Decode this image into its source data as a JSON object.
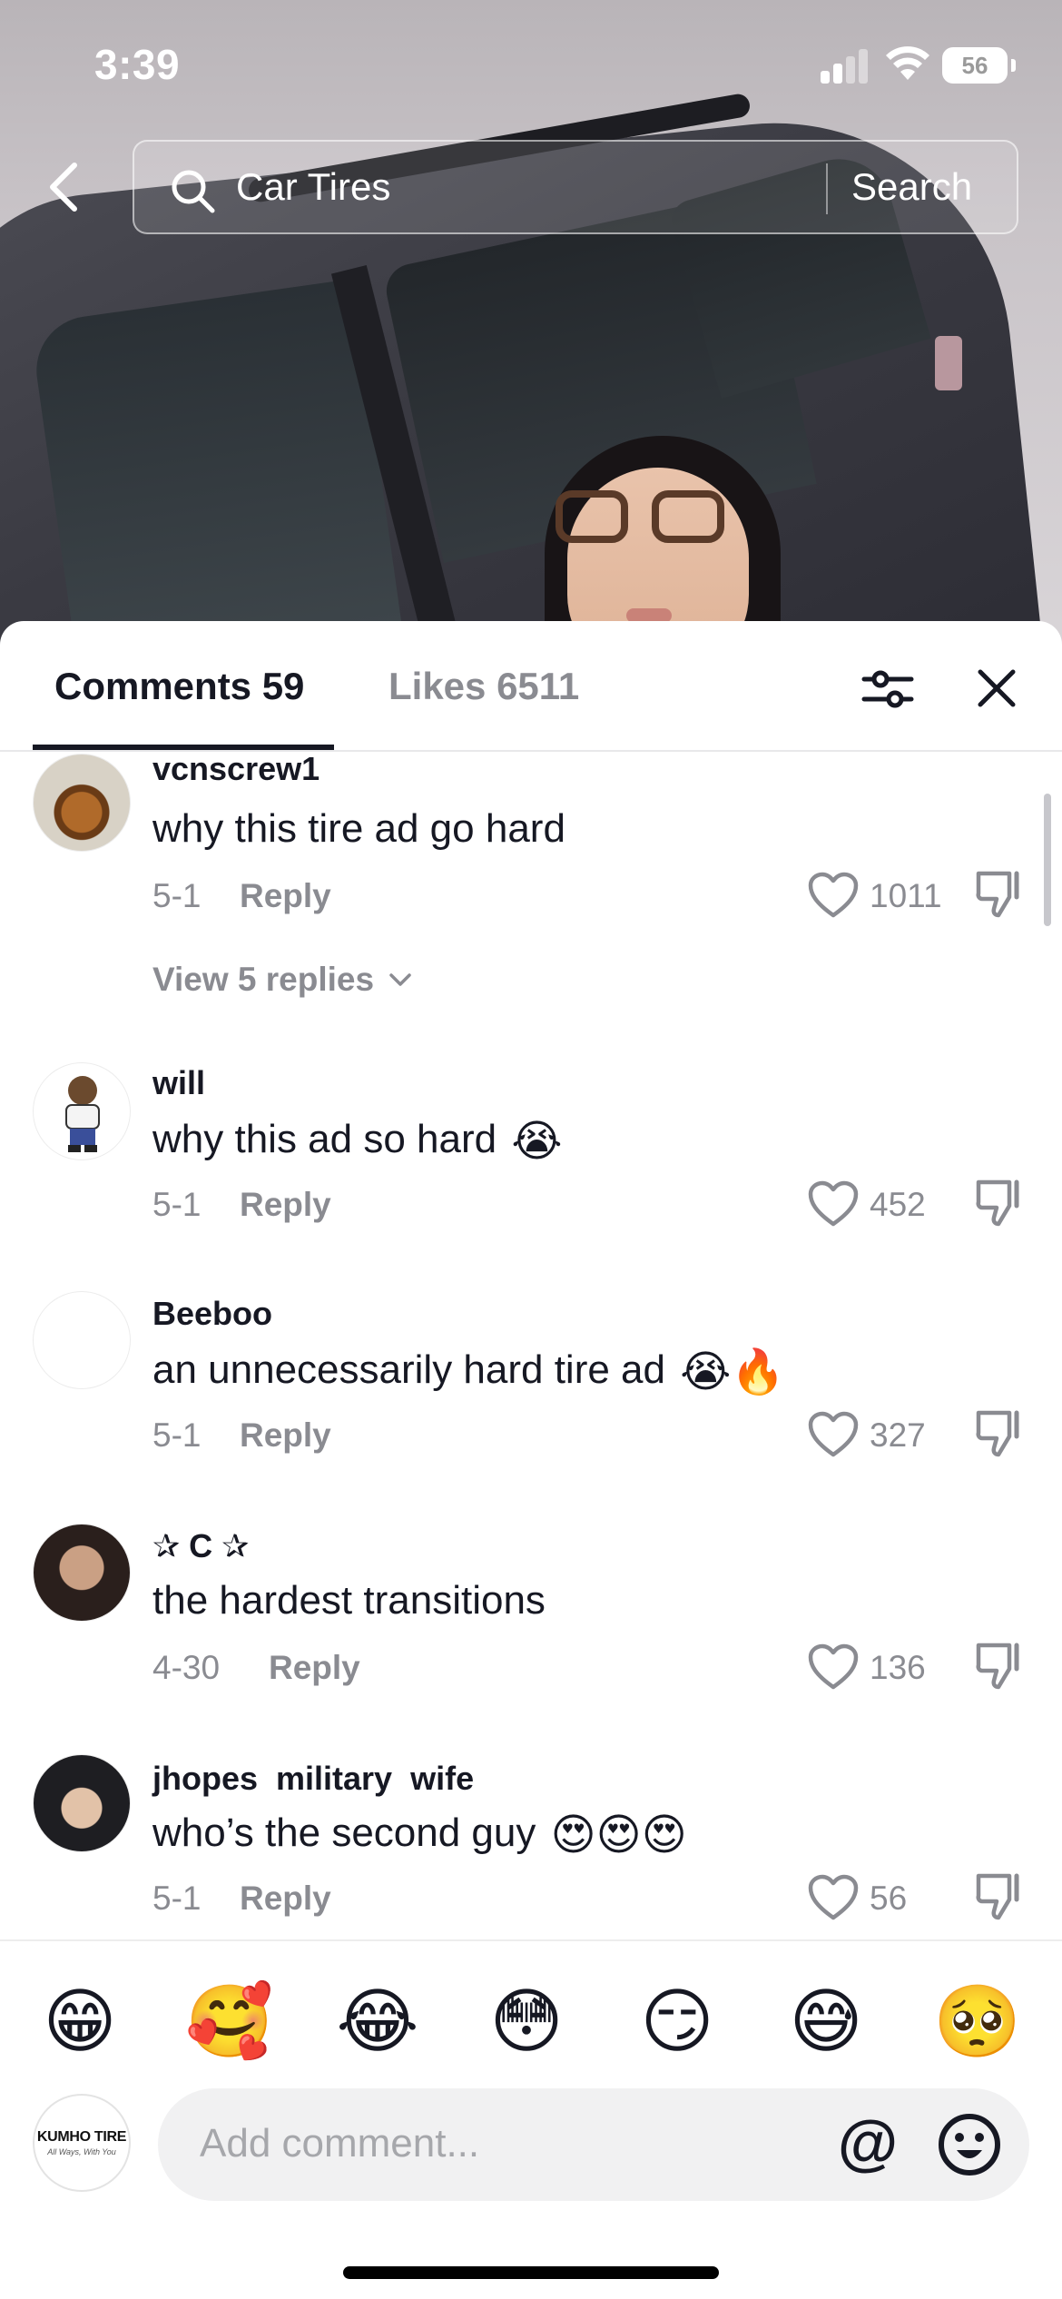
{
  "status_bar": {
    "time": "3:39",
    "battery": "56"
  },
  "search": {
    "query": "Car Tires",
    "button_label": "Search"
  },
  "tabs": {
    "comments": "Comments 59",
    "likes": "Likes 6511"
  },
  "comments": [
    {
      "username": "vcnscrew1",
      "text": "why this tire ad go hard",
      "date": "5-1",
      "reply_label": "Reply",
      "likes": "1011",
      "view_replies": "View 5 replies"
    },
    {
      "username": "will",
      "text": "why this ad so hard",
      "emoji": "😭",
      "date": "5-1",
      "reply_label": "Reply",
      "likes": "452"
    },
    {
      "username": "Beeboo",
      "text": "an unnecessarily hard tire ad",
      "emoji": "😭🔥",
      "date": "5-1",
      "reply_label": "Reply",
      "likes": "327"
    },
    {
      "username": "✰ C ✰",
      "text": "the hardest transitions",
      "date": "4-30",
      "reply_label": "Reply",
      "likes": "136"
    },
    {
      "username": "jhopes  military  wife",
      "text": "who’s the second guy",
      "emoji": "😍😍😍",
      "date": "5-1",
      "reply_label": "Reply",
      "likes": "56"
    }
  ],
  "emoji_bar": [
    "😁",
    "🥰",
    "😂",
    "😳",
    "😏",
    "😅",
    "🥺"
  ],
  "composer": {
    "placeholder": "Add comment...",
    "mention_symbol": "@",
    "brand_name": "KUMHO TIRE",
    "brand_tagline": "All Ways, With You"
  },
  "icons": {
    "back": "chevron-left-icon",
    "search": "magnifier-icon",
    "filter": "sliders-icon",
    "close": "close-icon",
    "like": "heart-outline-icon",
    "dislike": "thumbs-down-icon",
    "emoji_picker": "smiley-icon"
  },
  "colors": {
    "text_primary": "#161823",
    "text_secondary": "#8a8b91",
    "input_bg": "#f1f1f2"
  }
}
